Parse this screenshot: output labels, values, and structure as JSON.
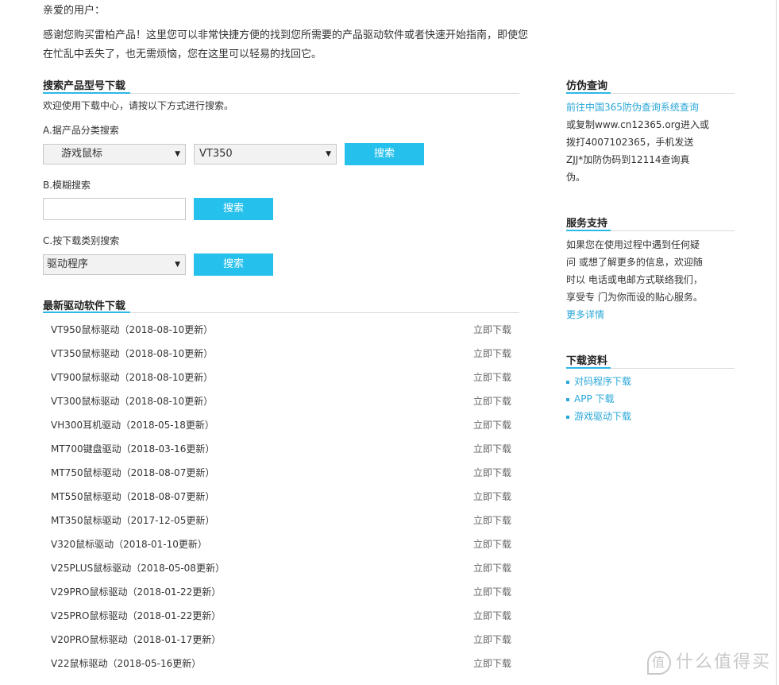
{
  "greeting": "亲爱的用户：",
  "intro": "感谢您购买雷柏产品！这里您可以非常快捷方便的找到您所需要的产品驱动软件或者快速开始指南，即使您在忙乱中丢失了，也无需烦恼，您在这里可以轻易的找回它。",
  "search": {
    "title": "搜索产品型号下载",
    "welcome": "欢迎使用下载中心，请按以下方式进行搜索。",
    "a_label": "A.据产品分类搜索",
    "a_category": "游戏鼠标",
    "a_model": "VT350",
    "a_button": "搜索",
    "b_label": "B.模糊搜索",
    "b_value": "",
    "b_button": "搜索",
    "c_label": "C.按下载类别搜索",
    "c_type": "驱动程序",
    "c_button": "搜索"
  },
  "latest": {
    "title": "最新驱动软件下载",
    "items": [
      {
        "name": "VT950鼠标驱动（2018-08-10更新）",
        "action": "立即下载"
      },
      {
        "name": "VT350鼠标驱动（2018-08-10更新）",
        "action": "立即下载"
      },
      {
        "name": "VT900鼠标驱动（2018-08-10更新）",
        "action": "立即下载"
      },
      {
        "name": "VT300鼠标驱动（2018-08-10更新）",
        "action": "立即下载"
      },
      {
        "name": "VH300耳机驱动（2018-05-18更新）",
        "action": "立即下载"
      },
      {
        "name": "MT700键盘驱动（2018-03-16更新）",
        "action": "立即下载"
      },
      {
        "name": "MT750鼠标驱动（2018-08-07更新）",
        "action": "立即下载"
      },
      {
        "name": "MT550鼠标驱动（2018-08-07更新）",
        "action": "立即下载"
      },
      {
        "name": "MT350鼠标驱动（2017-12-05更新）",
        "action": "立即下载"
      },
      {
        "name": "V320鼠标驱动（2018-01-10更新）",
        "action": "立即下载"
      },
      {
        "name": "V25PLUS鼠标驱动（2018-05-08更新）",
        "action": "立即下载"
      },
      {
        "name": "V29PRO鼠标驱动（2018-01-22更新）",
        "action": "立即下载"
      },
      {
        "name": "V25PRO鼠标驱动（2018-01-22更新）",
        "action": "立即下载"
      },
      {
        "name": "V20PRO鼠标驱动（2018-01-17更新）",
        "action": "立即下载"
      },
      {
        "name": "V22鼠标驱动（2018-05-16更新）",
        "action": "立即下载"
      }
    ]
  },
  "sidebar": {
    "anti_fake": {
      "title": "仿伪查询",
      "link": "前往中国365防伪查询系统查询",
      "lines": [
        "或复制www.cn12365.org进入或",
        "拨打4007102365，手机发送",
        "ZJJ*加防伪码到12114查询真",
        "伪。"
      ]
    },
    "service": {
      "title": "服务支持",
      "lines": [
        "如果您在使用过程中遇到任何疑",
        "问 或想了解更多的信息，欢迎随",
        "时以 电话或电邮方式联络我们，",
        "享受专 门为你而设的贴心服务。"
      ],
      "more": "更多详情"
    },
    "downloads": {
      "title": "下载资料",
      "links": [
        "对码程序下载",
        "APP 下载",
        "游戏驱动下载"
      ]
    }
  },
  "watermark": {
    "text": "什么值得买",
    "icon": "zhi-logo-icon"
  }
}
